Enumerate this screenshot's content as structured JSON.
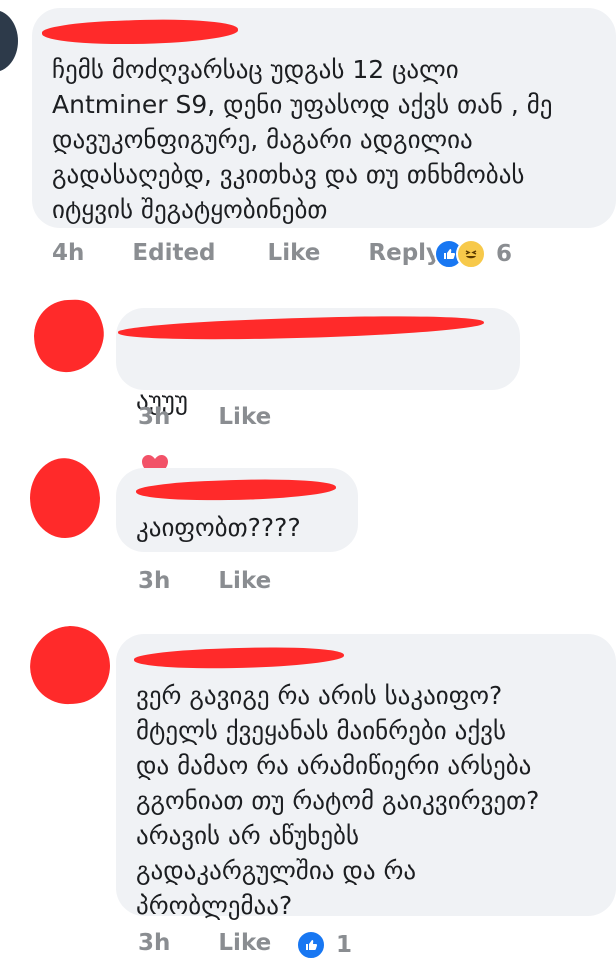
{
  "comments": [
    {
      "text": "ჩემს მოძღვარსაც უდგას 12 ცალი\nAntminer S9, დენი უფასოდ აქვს თან ,  მე\nდავუკონფიგურე, მაგარი ადგილია\nგადასაღებდ, ვკითხავ და თუ თნხმობას\nიტყვის შეგატყობინებთ",
      "time": "4h",
      "edited": "Edited",
      "like": "Like",
      "reply": "Reply",
      "reaction_count": "6"
    },
    {
      "text": "აუუუ",
      "time": "3h",
      "like": "Like"
    },
    {
      "text": "კაიფობთ????",
      "time": "3h",
      "like": "Like"
    },
    {
      "text": "ვერ გავიგე რა არის საკაიფო?\nმტელს ქვეყანას მაინრები აქვს\nდა მამაო რა არამიწიერი არსება\nგგონიათ თუ რატომ გაიკვირვეთ?\nარავის არ აწუხებს\nგადაკარგულშია და რა\nპრობლემაა?",
      "time": "3h",
      "like": "Like",
      "reaction_count": "1"
    }
  ],
  "colors": {
    "bubble": "#f0f2f5",
    "redaction": "#ff2a2a",
    "like_blue": "#1877f2",
    "meta": "#8a8d91"
  },
  "icons": [
    "like-reaction-icon",
    "haha-reaction-icon",
    "heart-emoji-icon"
  ]
}
